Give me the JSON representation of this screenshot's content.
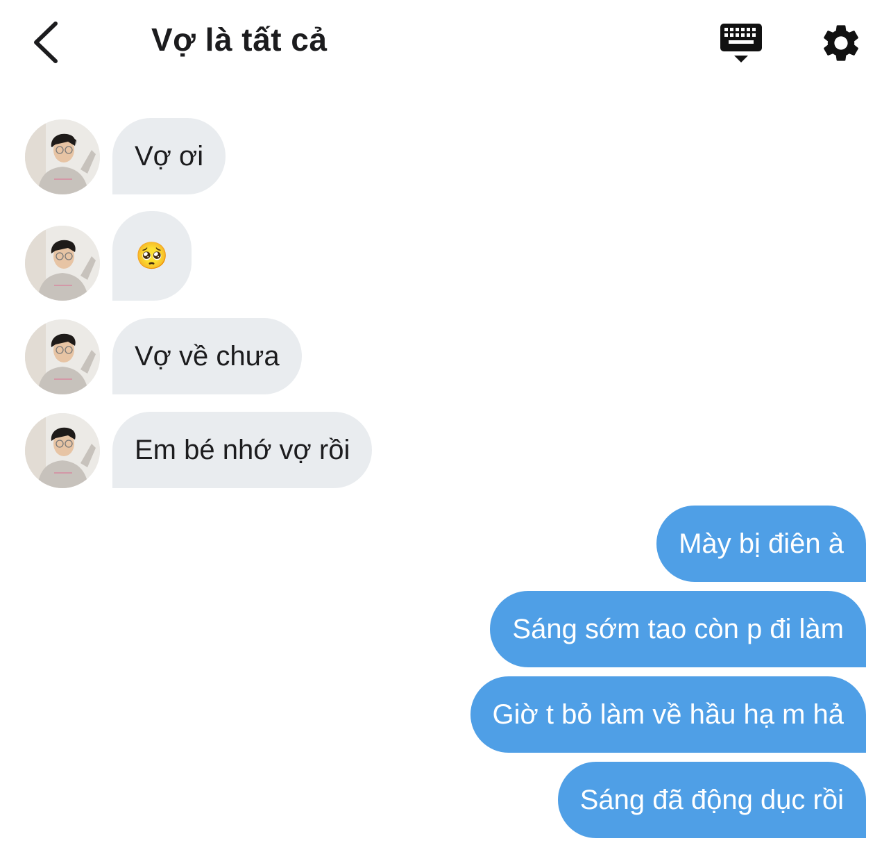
{
  "header": {
    "title": "Vợ là tất cả",
    "back_icon": "chevron-left-icon",
    "keyboard_icon": "keyboard-icon",
    "settings_icon": "gear-icon"
  },
  "messages": [
    {
      "direction": "incoming",
      "text": "Vợ ơi"
    },
    {
      "direction": "incoming",
      "text": "🥺"
    },
    {
      "direction": "incoming",
      "text": "Vợ về chưa"
    },
    {
      "direction": "incoming",
      "text": "Em bé nhớ vợ rồi"
    },
    {
      "direction": "outgoing",
      "text": "Mày bị điên à"
    },
    {
      "direction": "outgoing",
      "text": "Sáng sớm tao còn p đi làm"
    },
    {
      "direction": "outgoing",
      "text": "Giờ t bỏ làm về hầu hạ m hả"
    },
    {
      "direction": "outgoing",
      "text": "Sáng đã động dục rồi"
    }
  ],
  "colors": {
    "incoming_bubble": "#e9ecef",
    "outgoing_bubble": "#4f9fe6",
    "text_dark": "#1c1c1e"
  }
}
